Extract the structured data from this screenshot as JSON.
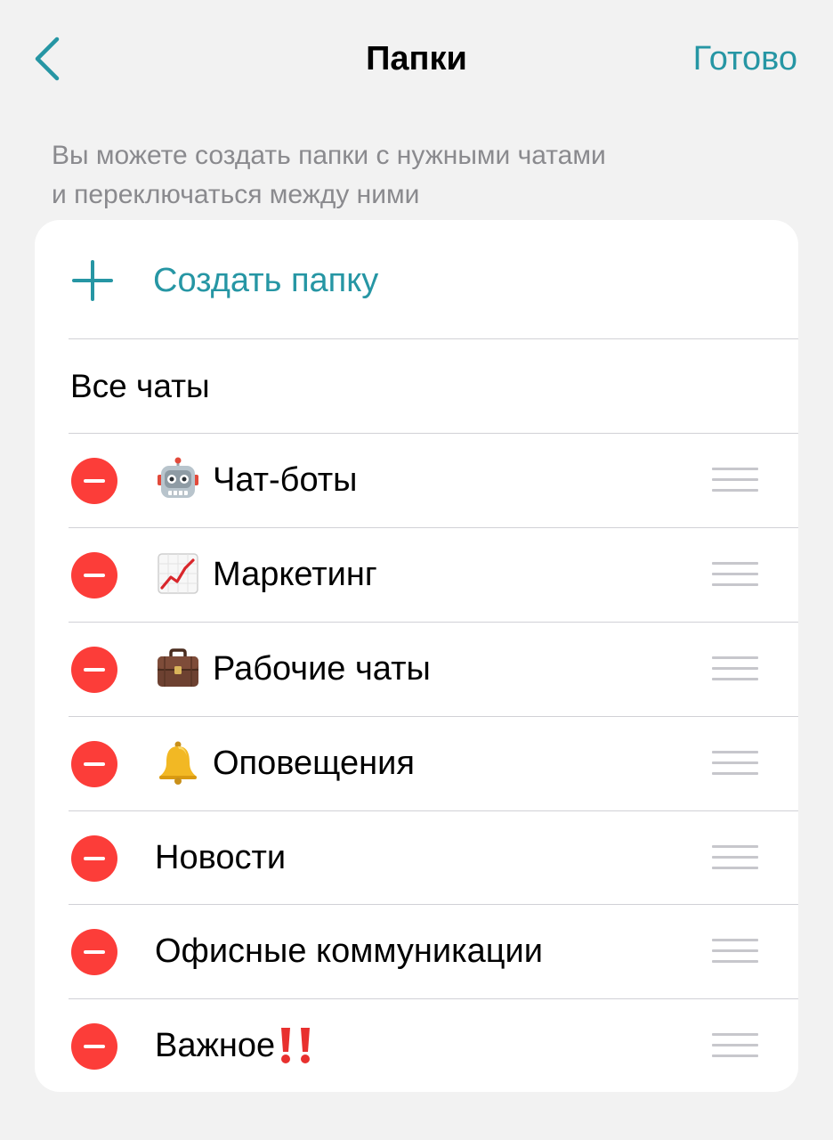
{
  "nav": {
    "title": "Папки",
    "done_label": "Готово",
    "back_icon": "chevron-left-icon"
  },
  "hint": {
    "line1": "Вы можете создать папки с нужными чатами",
    "line2": "и переключаться между ними"
  },
  "create": {
    "label": "Создать папку",
    "icon": "plus-icon"
  },
  "all_chats": {
    "label": "Все чаты"
  },
  "folders": [
    {
      "label": "Чат-боты",
      "emoji_icon": "robot-icon"
    },
    {
      "label": "Маркетинг",
      "emoji_icon": "chart-increasing-icon"
    },
    {
      "label": "Рабочие чаты",
      "emoji_icon": "briefcase-icon"
    },
    {
      "label": "Оповещения",
      "emoji_icon": "bell-icon"
    },
    {
      "label": "Новости",
      "emoji_icon": ""
    },
    {
      "label": "Офисные коммуникации",
      "emoji_icon": ""
    },
    {
      "label": "Важное",
      "emoji_icon": "double-exclamation-icon"
    }
  ],
  "colors": {
    "accent": "#2696a4",
    "remove": "#fc3d39",
    "background": "#f2f2f2",
    "card": "#ffffff",
    "hint_text": "#8a8a8e",
    "separator": "#d1d1d6",
    "drag_handle": "#c7c7cc"
  }
}
